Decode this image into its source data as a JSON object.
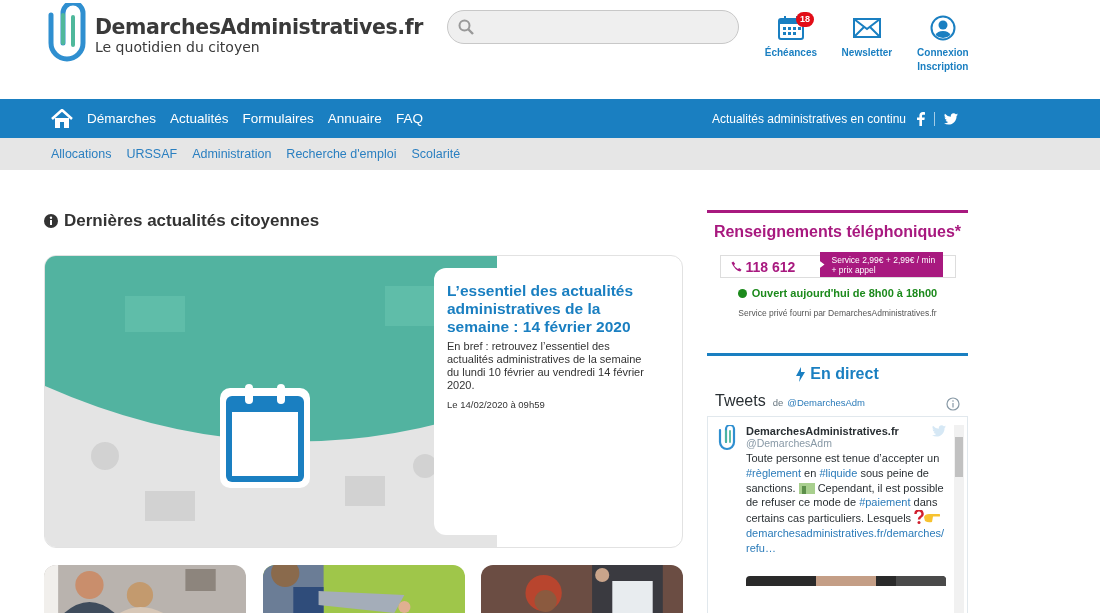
{
  "logo": {
    "name": "DemarchesAdministratives.fr",
    "tagline": "Le quotidien du citoyen"
  },
  "header_links": [
    {
      "kind": "calendar",
      "lines": [
        "Échéances"
      ],
      "badge": "18"
    },
    {
      "kind": "mail",
      "lines": [
        "Newsletter"
      ]
    },
    {
      "kind": "user",
      "lines": [
        "Connexion",
        "Inscription"
      ]
    }
  ],
  "nav": {
    "items": [
      "Démarches",
      "Actualités",
      "Formulaires",
      "Annuaire",
      "FAQ"
    ],
    "tagline": "Actualités administratives en continu"
  },
  "subnav": [
    "Allocations",
    "URSSAF",
    "Administration",
    "Recherche d'emploi",
    "Scolarité"
  ],
  "section_title": "Dernières actualités citoyennes",
  "featured": {
    "title": "L’essentiel des actualités administratives de la semaine : 14 février 2020",
    "summary": "En bref : retrouvez l’essentiel des actualités administratives de la semaine du lundi 10 février au vendredi 14 février 2020.",
    "date": "Le 14/02/2020 à 09h59"
  },
  "phone": {
    "title": "Renseignements téléphoniques*",
    "number": "118 612",
    "price": [
      "Service 2,99€ + 2,99€ / min",
      "+ prix appel"
    ],
    "open": true,
    "hours": "Ouvert aujourd'hui de 8h00 à 18h00",
    "note": "Service privé fourni par DemarchesAdministratives.fr"
  },
  "live": {
    "title": "En direct",
    "widget_title": "Tweets",
    "by": "de",
    "handle": "@DemarchesAdm",
    "tweet": {
      "author": "DemarchesAdministratives.fr",
      "handle": "@DemarchesAdm",
      "segments": [
        {
          "kind": "text",
          "text": "Toute personne est tenue d’accepter un "
        },
        {
          "kind": "tag",
          "text": "#règlement"
        },
        {
          "kind": "text",
          "text": " en "
        },
        {
          "kind": "tag",
          "text": "#liquide"
        },
        {
          "kind": "text",
          "text": " sous peine de sanctions. "
        },
        {
          "kind": "money"
        },
        {
          "kind": "text",
          "text": " Cependant, il est possible de refuser ce mode de "
        },
        {
          "kind": "tag",
          "text": "#paiement"
        },
        {
          "kind": "text",
          "text": " dans certains cas particuliers. Lesquels "
        },
        {
          "kind": "question"
        },
        {
          "kind": "hand"
        },
        {
          "kind": "link",
          "text": "demarchesadministratives.fr/demarches/refu…"
        }
      ]
    }
  }
}
